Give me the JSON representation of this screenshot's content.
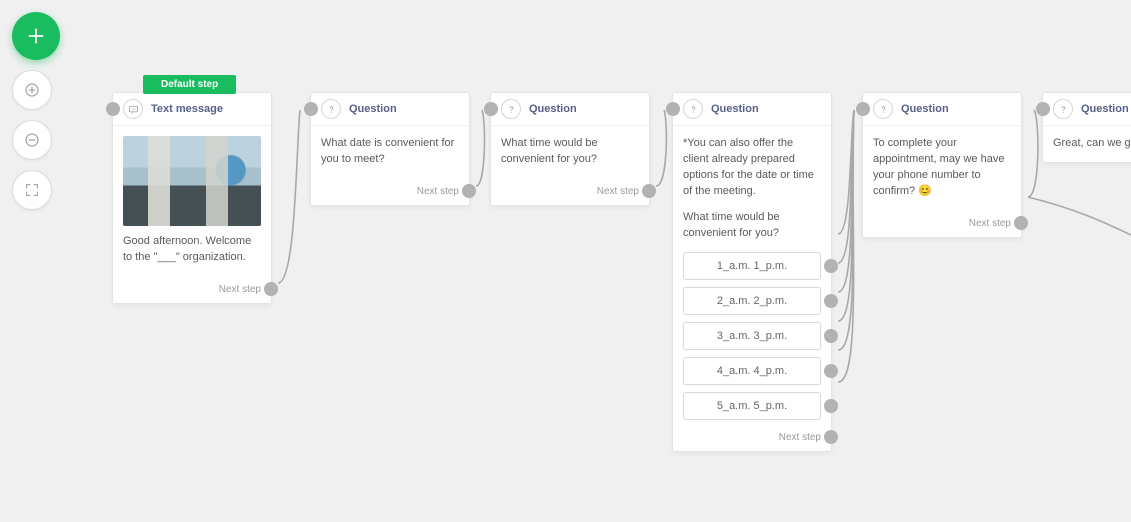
{
  "toolbar": {
    "add": "add",
    "zoom_in": "zoom-in",
    "zoom_out": "zoom-out",
    "fit": "fit-screen"
  },
  "labels": {
    "default_step": "Default step",
    "next_step": "Next step"
  },
  "nodes": {
    "n1": {
      "type_label": "Text message",
      "text": "Good afternoon. Welcome to the \"___\" organization."
    },
    "n2": {
      "type_label": "Question",
      "text": "What date is convenient for you to meet?"
    },
    "n3": {
      "type_label": "Question",
      "text": "What time would be convenient for you?"
    },
    "n4": {
      "type_label": "Question",
      "text_intro": "*You can also offer the client already prepared options for the date or time of the meeting.",
      "text_q": "What time would be convenient for you?",
      "options": [
        "1_a.m. 1_p.m.",
        "2_a.m. 2_p.m.",
        "3_a.m. 3_p.m.",
        "4_a.m. 4_p.m.",
        "5_a.m. 5_p.m."
      ]
    },
    "n5": {
      "type_label": "Question",
      "text": "To complete your appointment, may we have your phone number to confirm? 😊"
    },
    "n6": {
      "type_label": "Question",
      "text": "Great, can we get you"
    }
  }
}
